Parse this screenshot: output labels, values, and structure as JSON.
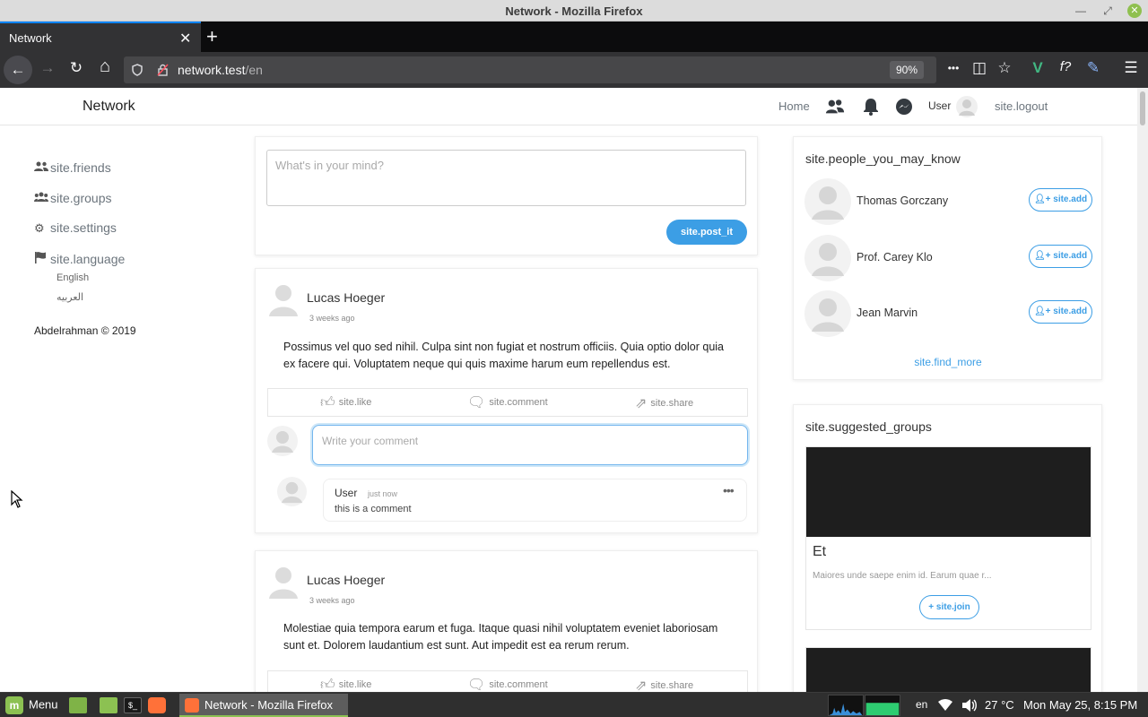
{
  "os": {
    "window_title": "Network - Mozilla Firefox",
    "minimize_glyph": "—",
    "maximize_glyph": "⤢",
    "close_glyph": "✕"
  },
  "browser": {
    "tab_label": "Network",
    "tab_close_glyph": "✕",
    "new_tab_glyph": "+",
    "url_host": "network.test",
    "url_path": "/en",
    "zoom": "90%",
    "icons": [
      "back-icon",
      "forward-icon",
      "reload-icon",
      "home-icon",
      "shield-icon",
      "lock-icon",
      "more-icon",
      "pocket-icon",
      "star-icon",
      "vue-devtools-icon",
      "formula-icon",
      "pen-icon",
      "hamburger-menu-icon"
    ],
    "glyphs": {
      "back": "←",
      "forward": "→",
      "reload": "↻",
      "home": "⌂",
      "more": "•••",
      "pocket": "◫",
      "star": "☆",
      "vue": "V",
      "formula": "f?",
      "pen": "✎",
      "menu": "☰"
    }
  },
  "site": {
    "brand": "Network",
    "nav": {
      "home": "Home",
      "user": "User",
      "logout": "site.logout"
    },
    "sidebar": {
      "items": [
        {
          "label": "site.friends",
          "icon": "users-icon"
        },
        {
          "label": "site.groups",
          "icon": "users-icon"
        },
        {
          "label": "site.settings",
          "icon": "gear-icon"
        },
        {
          "label": "site.language",
          "icon": "flag-icon"
        }
      ],
      "languages": [
        "English",
        "العربيه"
      ],
      "copyright": "Abdelrahman © 2019"
    },
    "composer": {
      "placeholder": "What's in your mind?",
      "submit": "site.post_it"
    },
    "posts": [
      {
        "author": "Lucas Hoeger",
        "time": "3 weeks ago",
        "body": "Possimus vel quo sed nihil. Culpa sint non fugiat et nostrum officiis. Quia optio dolor quia ex facere qui. Voluptatem neque qui quis maxime harum eum repellendus est.",
        "actions": {
          "like": "site.like",
          "comment": "site.comment",
          "share": "site.share"
        },
        "comment_placeholder": "Write your comment",
        "comments": [
          {
            "user": "User",
            "time": "just now",
            "text": "this is a comment",
            "menu": "•••"
          }
        ]
      },
      {
        "author": "Lucas Hoeger",
        "time": "3 weeks ago",
        "body": "Molestiae quia tempora earum et fuga. Itaque quasi nihil voluptatem eveniet laboriosam sunt et. Dolorem laudantium est sunt. Aut impedit est ea rerum rerum.",
        "actions": {
          "like": "site.like",
          "comment": "site.comment",
          "share": "site.share"
        }
      }
    ],
    "people": {
      "title": "site.people_you_may_know",
      "list": [
        {
          "name": "Thomas Gorczany",
          "action": "site.add"
        },
        {
          "name": "Prof. Carey Klo",
          "action": "site.add"
        },
        {
          "name": "Jean Marvin",
          "action": "site.add"
        }
      ],
      "find_more": "site.find_more"
    },
    "groups": {
      "title": "site.suggested_groups",
      "list": [
        {
          "name": "Et",
          "description": "Maiores unde saepe enim id. Earum quae r...",
          "action": "site.join"
        }
      ]
    }
  },
  "taskbar": {
    "menu_label": "Menu",
    "window_label": "Network - Mozilla Firefox",
    "keyboard": "en",
    "temperature": "27 °C",
    "clock": "Mon May 25,  8:15 PM"
  },
  "colors": {
    "accent": "#3c9ee5",
    "firefox_dark": "#323234",
    "mint_green": "#8cc152"
  }
}
